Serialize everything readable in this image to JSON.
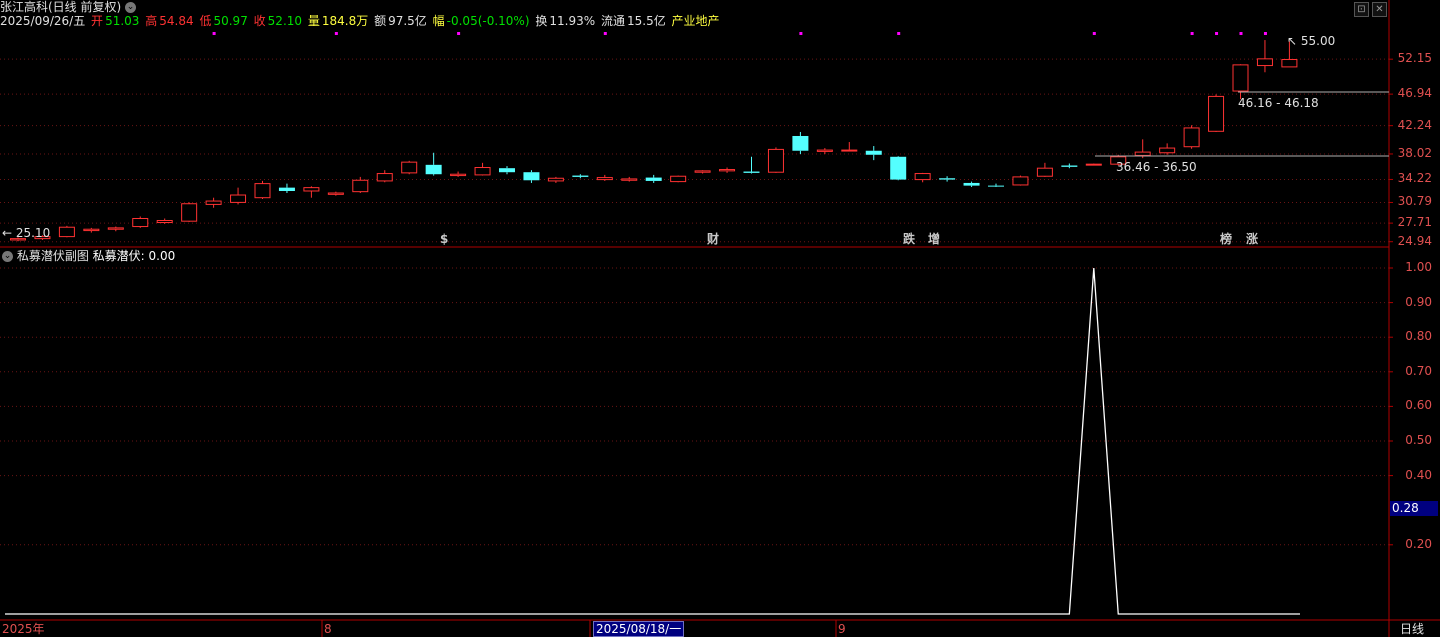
{
  "header": {
    "title": "张江高科(日线 前复权)",
    "date": "2025/09/26/五",
    "open_label": "开",
    "open": "51.03",
    "high_label": "高",
    "high": "54.84",
    "low_label": "低",
    "low": "50.97",
    "close_label": "收",
    "close": "52.10",
    "vol_label": "量",
    "vol": "184.8万",
    "amt_label": "额",
    "amt": "97.5亿",
    "chg_label": "幅",
    "chg": "-0.05(-0.10%)",
    "turnover_label": "换",
    "turnover": "11.93%",
    "float_label": "流通",
    "float": "15.5亿",
    "sector": "产业地产"
  },
  "colors": {
    "up": "#ff3232",
    "down": "#54ffff",
    "axis": "#b00000",
    "grid": "#6a1414",
    "line": "#ffffff",
    "magenta": "#ff00ff"
  },
  "price_axis": {
    "ticks": [
      "52.15",
      "46.94",
      "42.24",
      "38.02",
      "34.22",
      "30.79",
      "27.71",
      "24.94"
    ]
  },
  "indicator": {
    "title": "私募潜伏副图",
    "value_label": "私募潜伏: 0.00",
    "ticks": [
      "1.00",
      "0.90",
      "0.80",
      "0.70",
      "0.60",
      "0.50",
      "0.40",
      "0.20"
    ],
    "current": "0.28"
  },
  "annotations": {
    "max": "55.00",
    "min": "25.10",
    "range1": "46.16 - 46.18",
    "range2": "36.46 - 36.50"
  },
  "markers": [
    {
      "text": "$",
      "color": "#ff3232"
    },
    {
      "text": "财",
      "color": "#54ffff"
    },
    {
      "text": "跌",
      "color": "#00ff00"
    },
    {
      "text": "增",
      "color": "#ff3232"
    },
    {
      "text": "榜",
      "color": "#ffc864"
    },
    {
      "text": "涨",
      "color": "#ff3232"
    }
  ],
  "time_axis": {
    "labels": [
      "2025年",
      "8",
      "2025/08/18/一",
      "9"
    ],
    "period": "日线"
  },
  "chart_data": {
    "type": "candlestick",
    "candles": [
      {
        "o": 25.2,
        "h": 25.6,
        "l": 25.0,
        "c": 25.4
      },
      {
        "o": 25.4,
        "h": 25.9,
        "l": 25.2,
        "c": 25.7
      },
      {
        "o": 25.7,
        "h": 27.3,
        "l": 25.6,
        "c": 27.1
      },
      {
        "o": 26.6,
        "h": 27.0,
        "l": 26.3,
        "c": 26.8
      },
      {
        "o": 26.8,
        "h": 27.2,
        "l": 26.5,
        "c": 27.0
      },
      {
        "o": 27.2,
        "h": 28.7,
        "l": 27.0,
        "c": 28.4
      },
      {
        "o": 27.8,
        "h": 28.4,
        "l": 27.6,
        "c": 28.1
      },
      {
        "o": 28.0,
        "h": 30.8,
        "l": 27.9,
        "c": 30.6
      },
      {
        "o": 30.5,
        "h": 31.5,
        "l": 30.0,
        "c": 31.0
      },
      {
        "o": 30.8,
        "h": 33.0,
        "l": 30.5,
        "c": 31.9
      },
      {
        "o": 31.5,
        "h": 34.0,
        "l": 31.3,
        "c": 33.6
      },
      {
        "o": 33.0,
        "h": 33.6,
        "l": 32.2,
        "c": 32.5
      },
      {
        "o": 32.5,
        "h": 33.2,
        "l": 31.5,
        "c": 33.0
      },
      {
        "o": 32.0,
        "h": 32.4,
        "l": 31.8,
        "c": 32.2
      },
      {
        "o": 32.4,
        "h": 34.6,
        "l": 32.2,
        "c": 34.1
      },
      {
        "o": 34.0,
        "h": 35.6,
        "l": 33.8,
        "c": 35.1
      },
      {
        "o": 35.2,
        "h": 37.0,
        "l": 35.0,
        "c": 36.8
      },
      {
        "o": 36.4,
        "h": 38.2,
        "l": 34.8,
        "c": 35.0
      },
      {
        "o": 34.8,
        "h": 35.4,
        "l": 34.6,
        "c": 35.0
      },
      {
        "o": 34.9,
        "h": 36.7,
        "l": 34.8,
        "c": 36.0
      },
      {
        "o": 35.9,
        "h": 36.2,
        "l": 35.0,
        "c": 35.3
      },
      {
        "o": 35.3,
        "h": 35.6,
        "l": 33.7,
        "c": 34.1
      },
      {
        "o": 34.0,
        "h": 34.6,
        "l": 33.7,
        "c": 34.4
      },
      {
        "o": 34.8,
        "h": 35.0,
        "l": 34.4,
        "c": 34.6
      },
      {
        "o": 34.2,
        "h": 34.9,
        "l": 34.0,
        "c": 34.5
      },
      {
        "o": 34.1,
        "h": 34.6,
        "l": 33.9,
        "c": 34.3
      },
      {
        "o": 34.5,
        "h": 34.9,
        "l": 33.7,
        "c": 34.0
      },
      {
        "o": 33.9,
        "h": 34.8,
        "l": 33.8,
        "c": 34.7
      },
      {
        "o": 35.3,
        "h": 35.6,
        "l": 35.1,
        "c": 35.5
      },
      {
        "o": 35.5,
        "h": 36.0,
        "l": 35.2,
        "c": 35.7
      },
      {
        "o": 35.4,
        "h": 37.6,
        "l": 35.1,
        "c": 35.2
      },
      {
        "o": 35.3,
        "h": 39.0,
        "l": 35.2,
        "c": 38.7
      },
      {
        "o": 40.7,
        "h": 41.3,
        "l": 38.0,
        "c": 38.5
      },
      {
        "o": 38.4,
        "h": 38.9,
        "l": 38.0,
        "c": 38.6
      },
      {
        "o": 38.6,
        "h": 39.8,
        "l": 38.5,
        "c": 38.6
      },
      {
        "o": 38.5,
        "h": 39.2,
        "l": 37.1,
        "c": 37.9
      },
      {
        "o": 37.6,
        "h": 37.7,
        "l": 34.1,
        "c": 34.2
      },
      {
        "o": 34.2,
        "h": 35.2,
        "l": 33.8,
        "c": 35.1
      },
      {
        "o": 34.4,
        "h": 34.7,
        "l": 33.9,
        "c": 34.2
      },
      {
        "o": 33.7,
        "h": 33.9,
        "l": 33.1,
        "c": 33.3
      },
      {
        "o": 33.3,
        "h": 33.6,
        "l": 33.1,
        "c": 33.2
      },
      {
        "o": 33.4,
        "h": 34.8,
        "l": 33.3,
        "c": 34.6
      },
      {
        "o": 34.7,
        "h": 36.7,
        "l": 34.6,
        "c": 35.9
      },
      {
        "o": 36.3,
        "h": 36.6,
        "l": 35.9,
        "c": 36.1
      },
      {
        "o": 36.4,
        "h": 36.6,
        "l": 36.3,
        "c": 36.5
      },
      {
        "o": 36.5,
        "h": 37.9,
        "l": 36.3,
        "c": 37.6
      },
      {
        "o": 37.8,
        "h": 40.2,
        "l": 37.4,
        "c": 38.3
      },
      {
        "o": 38.2,
        "h": 39.6,
        "l": 37.9,
        "c": 38.9
      },
      {
        "o": 39.1,
        "h": 42.3,
        "l": 38.8,
        "c": 41.9
      },
      {
        "o": 41.4,
        "h": 46.9,
        "l": 41.3,
        "c": 46.6
      },
      {
        "o": 47.4,
        "h": 51.4,
        "l": 46.2,
        "c": 51.3
      },
      {
        "o": 51.2,
        "h": 55.0,
        "l": 50.2,
        "c": 52.2
      },
      {
        "o": 51.0,
        "h": 54.8,
        "l": 51.0,
        "c": 52.1
      }
    ],
    "indicator_series": [
      0,
      0,
      0,
      0,
      0,
      0,
      0,
      0,
      0,
      0,
      0,
      0,
      0,
      0,
      0,
      0,
      0,
      0,
      0,
      0,
      0,
      0,
      0,
      0,
      0,
      0,
      0,
      0,
      0,
      0,
      0,
      0,
      0,
      0,
      0,
      0,
      0,
      0,
      0,
      0,
      0,
      0,
      0,
      0,
      1,
      0,
      0,
      0,
      0,
      0,
      0,
      0,
      0
    ],
    "price_range": [
      24.3,
      56.5
    ],
    "indicator_range": [
      0,
      1.0
    ]
  }
}
